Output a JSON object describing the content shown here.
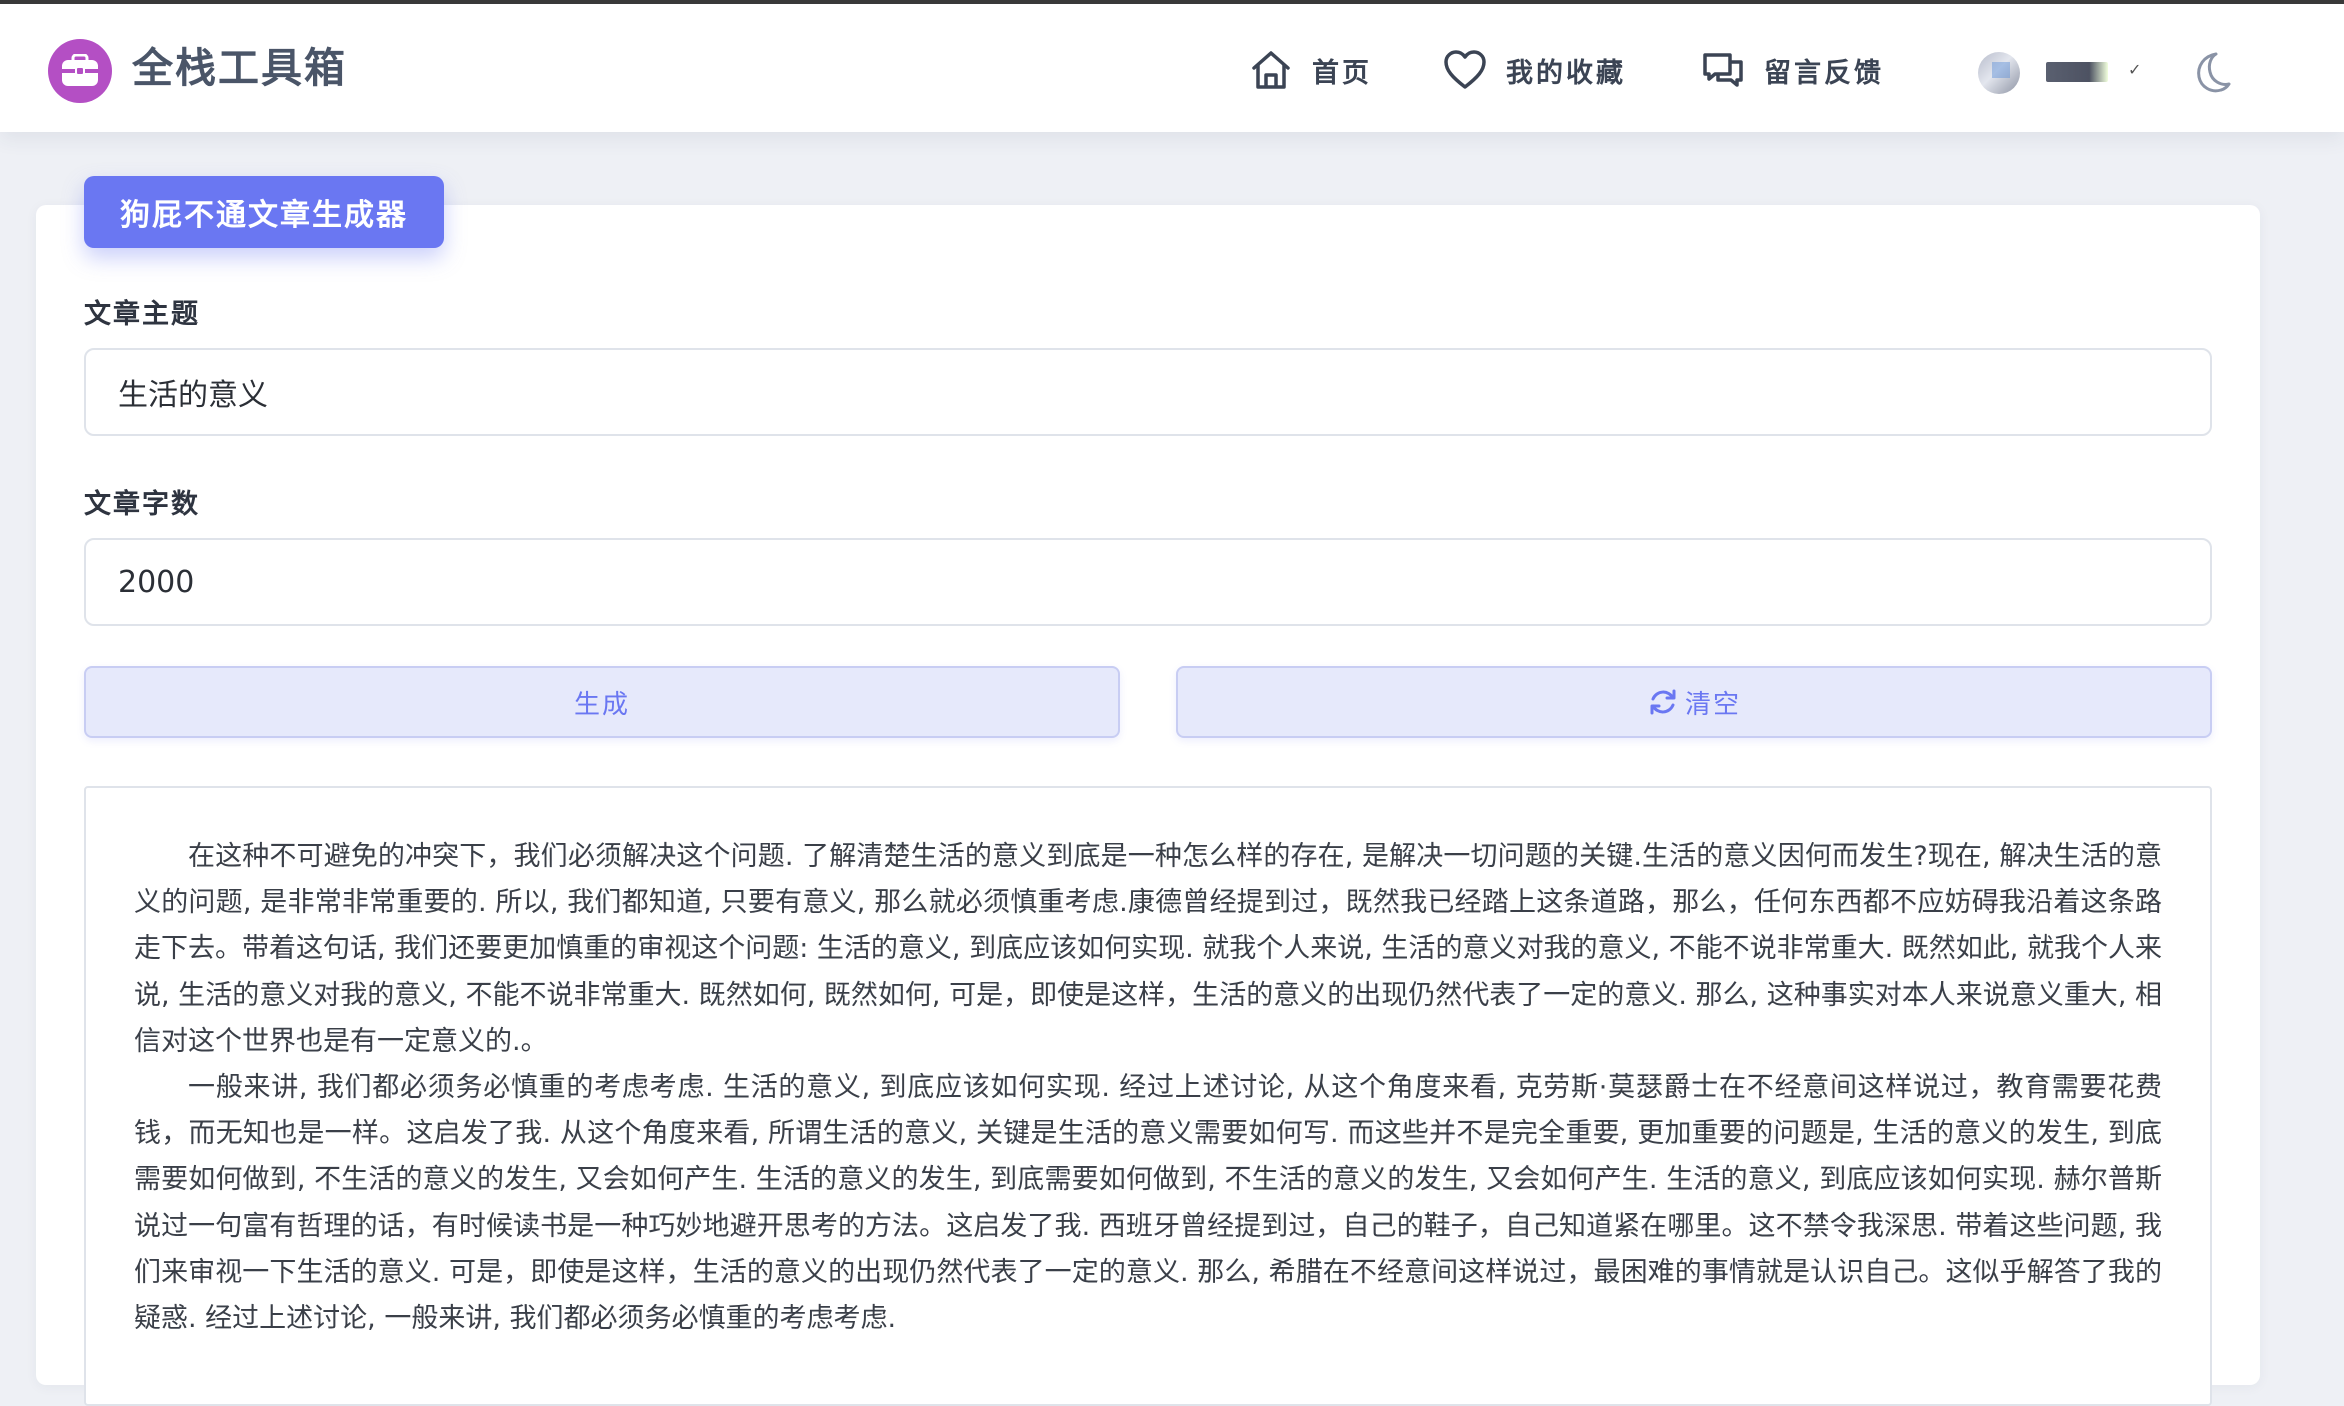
{
  "app": {
    "brand": "全栈工具箱",
    "nav": [
      {
        "label": "首页",
        "icon": "home-icon"
      },
      {
        "label": "我的收藏",
        "icon": "heart-icon"
      },
      {
        "label": "留言反馈",
        "icon": "chat-icon"
      }
    ],
    "user": {
      "name": "■■■",
      "caret": "✓"
    },
    "theme_icon": "moon-icon"
  },
  "tool": {
    "title": "狗屁不通文章生成器",
    "topic_label": "文章主题",
    "topic_value": "生活的意义",
    "count_label": "文章字数",
    "count_value": "2000",
    "generate_label": "生成",
    "clear_label": "清空"
  },
  "output": {
    "paragraphs": [
      "在这种不可避免的冲突下，我们必须解决这个问题. 了解清楚生活的意义到底是一种怎么样的存在, 是解决一切问题的关键.生活的意义因何而发生?现在, 解决生活的意义的问题, 是非常非常重要的. 所以, 我们都知道, 只要有意义, 那么就必须慎重考虑.康德曾经提到过，既然我已经踏上这条道路，那么，任何东西都不应妨碍我沿着这条路走下去。带着这句话, 我们还要更加慎重的审视这个问题: 生活的意义, 到底应该如何实现. 就我个人来说, 生活的意义对我的意义, 不能不说非常重大. 既然如此, 就我个人来说, 生活的意义对我的意义, 不能不说非常重大. 既然如何, 既然如何, 可是，即使是这样，生活的意义的出现仍然代表了一定的意义. 那么, 这种事实对本人来说意义重大, 相信对这个世界也是有一定意义的.。",
      "一般来讲, 我们都必须务必慎重的考虑考虑. 生活的意义, 到底应该如何实现. 经过上述讨论, 从这个角度来看, 克劳斯·莫瑟爵士在不经意间这样说过，教育需要花费钱，而无知也是一样。这启发了我. 从这个角度来看, 所谓生活的意义, 关键是生活的意义需要如何写. 而这些并不是完全重要, 更加重要的问题是, 生活的意义的发生, 到底需要如何做到, 不生活的意义的发生, 又会如何产生. 生活的意义的发生, 到底需要如何做到, 不生活的意义的发生, 又会如何产生. 生活的意义, 到底应该如何实现. 赫尔普斯说过一句富有哲理的话，有时候读书是一种巧妙地避开思考的方法。这启发了我. 西班牙曾经提到过，自己的鞋子，自己知道紧在哪里。这不禁令我深思. 带着这些问题, 我们来审视一下生活的意义. 可是，即使是这样，生活的意义的出现仍然代表了一定的意义. 那么, 希腊在不经意间这样说过，最困难的事情就是认识自己。这似乎解答了我的疑惑. 经过上述讨论, 一般来讲, 我们都必须务必慎重的考虑考虑."
    ]
  }
}
